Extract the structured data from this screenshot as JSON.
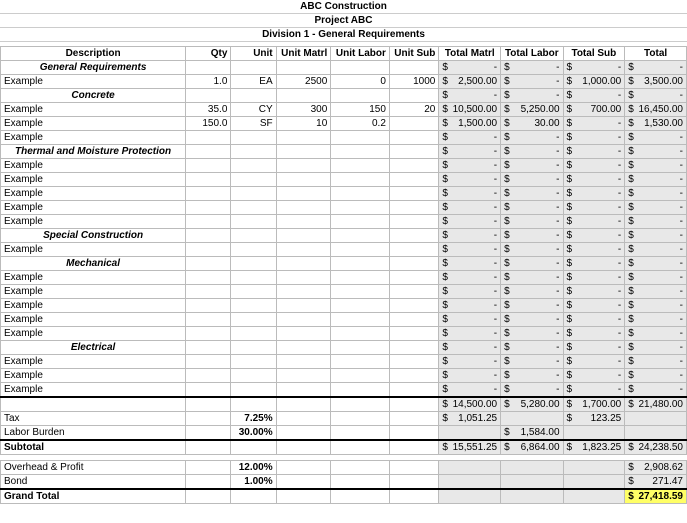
{
  "header": {
    "company": "ABC Construction",
    "project": "Project ABC",
    "division": "Division 1 - General Requirements"
  },
  "columns": {
    "description": "Description",
    "qty": "Qty",
    "unit": "Unit",
    "unit_matrl": "Unit Matrl",
    "unit_labor": "Unit Labor",
    "unit_sub": "Unit Sub",
    "total_matrl": "Total Matrl",
    "total_labor": "Total Labor",
    "total_sub": "Total Sub",
    "total": "Total"
  },
  "rows": [
    {
      "type": "section",
      "name": "General Requirements",
      "tm": "-",
      "tl": "-",
      "ts": "-",
      "tt": "-"
    },
    {
      "type": "item",
      "desc": "Example",
      "qty": "1.0",
      "unit": "EA",
      "um": "2500",
      "ul": "0",
      "us": "1000",
      "tm": "2,500.00",
      "tl": "-",
      "ts": "1,000.00",
      "tt": "3,500.00"
    },
    {
      "type": "section",
      "name": "Concrete",
      "tm": "-",
      "tl": "-",
      "ts": "-",
      "tt": "-"
    },
    {
      "type": "item",
      "desc": "Example",
      "qty": "35.0",
      "unit": "CY",
      "um": "300",
      "ul": "150",
      "us": "20",
      "tm": "10,500.00",
      "tl": "5,250.00",
      "ts": "700.00",
      "tt": "16,450.00"
    },
    {
      "type": "item",
      "desc": "Example",
      "qty": "150.0",
      "unit": "SF",
      "um": "10",
      "ul": "0.2",
      "us": "",
      "tm": "1,500.00",
      "tl": "30.00",
      "ts": "-",
      "tt": "1,530.00"
    },
    {
      "type": "item",
      "desc": "Example",
      "qty": "",
      "unit": "",
      "um": "",
      "ul": "",
      "us": "",
      "tm": "-",
      "tl": "-",
      "ts": "-",
      "tt": "-"
    },
    {
      "type": "section",
      "name": "Thermal and Moisture Protection",
      "tm": "-",
      "tl": "-",
      "ts": "-",
      "tt": "-"
    },
    {
      "type": "item",
      "desc": "Example",
      "qty": "",
      "unit": "",
      "um": "",
      "ul": "",
      "us": "",
      "tm": "-",
      "tl": "-",
      "ts": "-",
      "tt": "-"
    },
    {
      "type": "item",
      "desc": "Example",
      "qty": "",
      "unit": "",
      "um": "",
      "ul": "",
      "us": "",
      "tm": "-",
      "tl": "-",
      "ts": "-",
      "tt": "-"
    },
    {
      "type": "item",
      "desc": "Example",
      "qty": "",
      "unit": "",
      "um": "",
      "ul": "",
      "us": "",
      "tm": "-",
      "tl": "-",
      "ts": "-",
      "tt": "-"
    },
    {
      "type": "item",
      "desc": "Example",
      "qty": "",
      "unit": "",
      "um": "",
      "ul": "",
      "us": "",
      "tm": "-",
      "tl": "-",
      "ts": "-",
      "tt": "-"
    },
    {
      "type": "item",
      "desc": "Example",
      "qty": "",
      "unit": "",
      "um": "",
      "ul": "",
      "us": "",
      "tm": "-",
      "tl": "-",
      "ts": "-",
      "tt": "-"
    },
    {
      "type": "section",
      "name": "Special Construction",
      "tm": "-",
      "tl": "-",
      "ts": "-",
      "tt": "-"
    },
    {
      "type": "item",
      "desc": "Example",
      "qty": "",
      "unit": "",
      "um": "",
      "ul": "",
      "us": "",
      "tm": "-",
      "tl": "-",
      "ts": "-",
      "tt": "-"
    },
    {
      "type": "section",
      "name": "Mechanical",
      "tm": "-",
      "tl": "-",
      "ts": "-",
      "tt": "-"
    },
    {
      "type": "item",
      "desc": "Example",
      "qty": "",
      "unit": "",
      "um": "",
      "ul": "",
      "us": "",
      "tm": "-",
      "tl": "-",
      "ts": "-",
      "tt": "-"
    },
    {
      "type": "item",
      "desc": "Example",
      "qty": "",
      "unit": "",
      "um": "",
      "ul": "",
      "us": "",
      "tm": "-",
      "tl": "-",
      "ts": "-",
      "tt": "-"
    },
    {
      "type": "item",
      "desc": "Example",
      "qty": "",
      "unit": "",
      "um": "",
      "ul": "",
      "us": "",
      "tm": "-",
      "tl": "-",
      "ts": "-",
      "tt": "-"
    },
    {
      "type": "item",
      "desc": "Example",
      "qty": "",
      "unit": "",
      "um": "",
      "ul": "",
      "us": "",
      "tm": "-",
      "tl": "-",
      "ts": "-",
      "tt": "-"
    },
    {
      "type": "item",
      "desc": "Example",
      "qty": "",
      "unit": "",
      "um": "",
      "ul": "",
      "us": "",
      "tm": "-",
      "tl": "-",
      "ts": "-",
      "tt": "-"
    },
    {
      "type": "section",
      "name": "Electrical",
      "tm": "-",
      "tl": "-",
      "ts": "-",
      "tt": "-"
    },
    {
      "type": "item",
      "desc": "Example",
      "qty": "",
      "unit": "",
      "um": "",
      "ul": "",
      "us": "",
      "tm": "-",
      "tl": "-",
      "ts": "-",
      "tt": "-"
    },
    {
      "type": "item",
      "desc": "Example",
      "qty": "",
      "unit": "",
      "um": "",
      "ul": "",
      "us": "",
      "tm": "-",
      "tl": "-",
      "ts": "-",
      "tt": "-"
    },
    {
      "type": "item",
      "desc": "Example",
      "qty": "",
      "unit": "",
      "um": "",
      "ul": "",
      "us": "",
      "tm": "-",
      "tl": "-",
      "ts": "-",
      "tt": "-"
    }
  ],
  "subtotals": {
    "line_totals": {
      "tm": "14,500.00",
      "tl": "5,280.00",
      "ts": "1,700.00",
      "tt": "21,480.00"
    },
    "tax": {
      "label": "Tax",
      "pct": "7.25%",
      "tm": "1,051.25",
      "ts": "123.25"
    },
    "labor_burden": {
      "label": "Labor Burden",
      "pct": "30.00%",
      "tl": "1,584.00"
    },
    "subtotal": {
      "label": "Subtotal",
      "tm": "15,551.25",
      "tl": "6,864.00",
      "ts": "1,823.25",
      "tt": "24,238.50"
    },
    "overhead": {
      "label": "Overhead & Profit",
      "pct": "12.00%",
      "tt": "2,908.62"
    },
    "bond": {
      "label": "Bond",
      "pct": "1.00%",
      "tt": "271.47"
    },
    "grand": {
      "label": "Grand Total",
      "tt": "27,418.59"
    }
  },
  "currency": "$"
}
